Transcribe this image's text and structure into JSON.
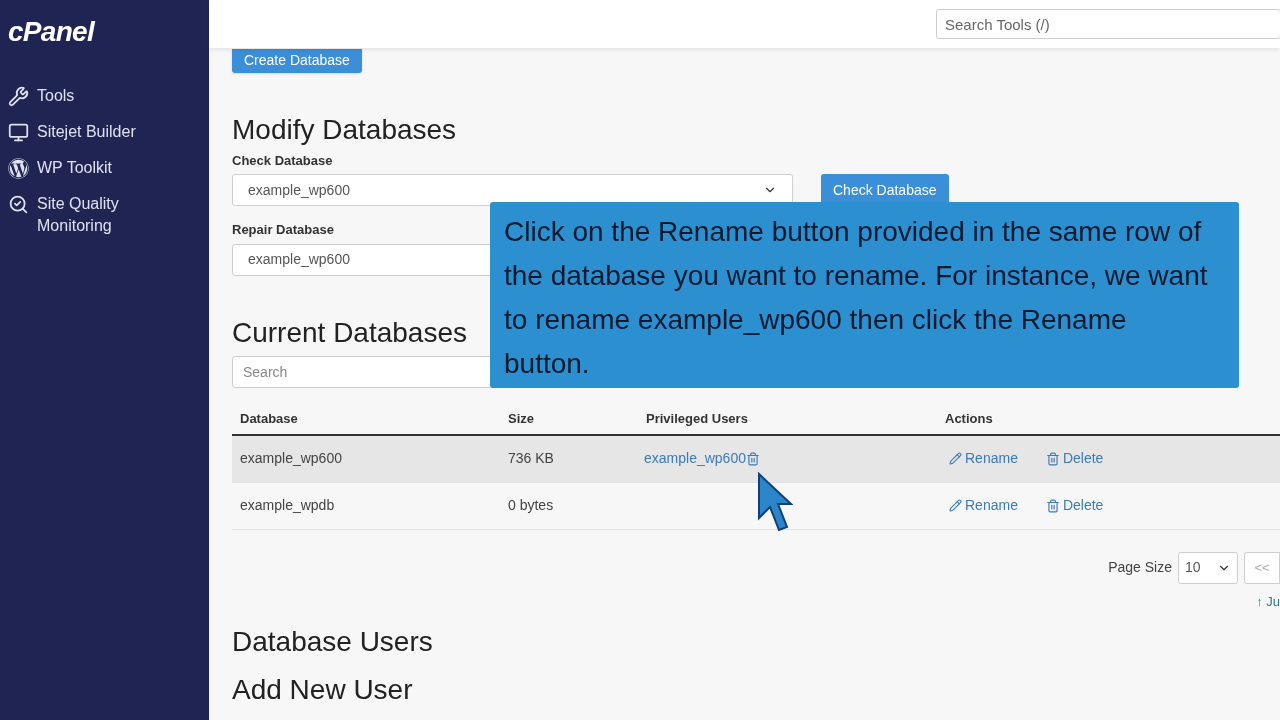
{
  "sidebar": {
    "logo": "cPanel",
    "items": [
      {
        "label": "Tools"
      },
      {
        "label": "Sitejet Builder"
      },
      {
        "label": "WP Toolkit"
      },
      {
        "label": "Site Quality Monitoring"
      }
    ]
  },
  "header": {
    "search": {
      "placeholder": "Search Tools (/)"
    }
  },
  "create_button": "Create Database",
  "modify": {
    "title": "Modify Databases",
    "check": {
      "label": "Check Database",
      "value": "example_wp600",
      "button": "Check Database"
    },
    "repair": {
      "label": "Repair Database",
      "value": "example_wp600"
    }
  },
  "current": {
    "title": "Current Databases",
    "search": {
      "placeholder": "Search"
    },
    "table": {
      "columns": [
        "Database",
        "Size",
        "Privileged Users",
        "Actions"
      ],
      "rows": [
        {
          "database": "example_wp600",
          "size": "736 KB",
          "users": [
            "example_wp600"
          ],
          "rename": "Rename",
          "delete": "Delete",
          "highlighted": true
        },
        {
          "database": "example_wpdb",
          "size": "0 bytes",
          "users": [],
          "rename": "Rename",
          "delete": "Delete",
          "highlighted": false
        }
      ]
    },
    "page_size": {
      "label": "Page Size",
      "value": "10"
    },
    "first_page": "<<",
    "jump": "↑ Ju"
  },
  "users_title": "Database Users",
  "add_user_title": "Add New User",
  "callout": "Click on the Rename button provided in the same row of the database you want to rename. For instance, we want to rename example_wp600 then click the Rename button."
}
